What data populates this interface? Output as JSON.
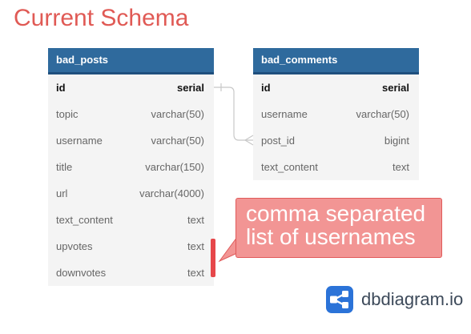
{
  "title": "Current Schema",
  "tables": {
    "bad_posts": {
      "name": "bad_posts",
      "columns": [
        {
          "name": "id",
          "type": "serial",
          "pk": true
        },
        {
          "name": "topic",
          "type": "varchar(50)"
        },
        {
          "name": "username",
          "type": "varchar(50)"
        },
        {
          "name": "title",
          "type": "varchar(150)"
        },
        {
          "name": "url",
          "type": "varchar(4000)"
        },
        {
          "name": "text_content",
          "type": "text"
        },
        {
          "name": "upvotes",
          "type": "text"
        },
        {
          "name": "downvotes",
          "type": "text"
        }
      ]
    },
    "bad_comments": {
      "name": "bad_comments",
      "columns": [
        {
          "name": "id",
          "type": "serial",
          "pk": true
        },
        {
          "name": "username",
          "type": "varchar(50)"
        },
        {
          "name": "post_id",
          "type": "bigint"
        },
        {
          "name": "text_content",
          "type": "text"
        }
      ]
    }
  },
  "relationship": {
    "from": "bad_posts.id",
    "to": "bad_comments.post_id"
  },
  "note": {
    "line1": "comma separated",
    "line2": "list of usernames"
  },
  "brand": {
    "name": "dbdiagram.io",
    "logo_icon": "dbdiagram-logo-icon"
  },
  "colors": {
    "title": "#e05a55",
    "table_header": "#2f6a9d",
    "note_fill": "#f29594",
    "highlight": "#e6474a"
  }
}
